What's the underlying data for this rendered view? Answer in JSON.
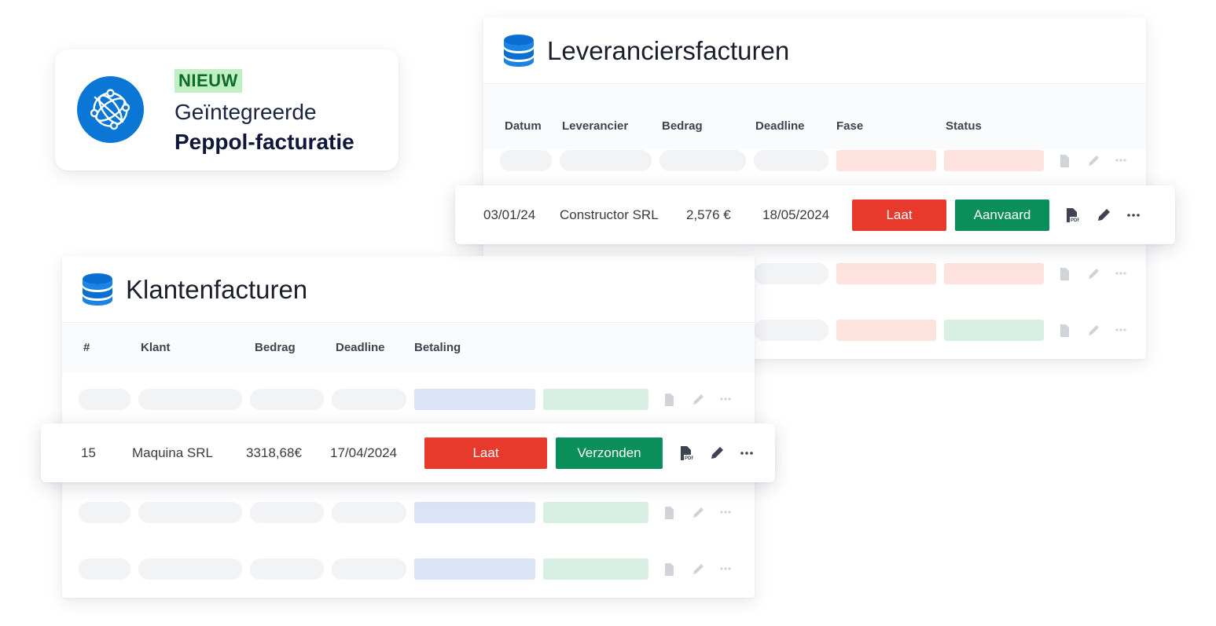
{
  "promo": {
    "tag": "NIEUW",
    "line1": "Geïntegreerde",
    "line2": "Peppol-facturatie"
  },
  "supplier": {
    "title": "Leveranciersfacturen",
    "columns": [
      "Datum",
      "Leverancier",
      "Bedrag",
      "Deadline",
      "Fase",
      "Status"
    ],
    "highlight": {
      "date": "03/01/24",
      "supplier": "Constructor SRL",
      "amount": "2,576 €",
      "deadline": "18/05/2024",
      "phase": "Laat",
      "status": "Aanvaard"
    }
  },
  "client": {
    "title": "Klantenfacturen",
    "columns": [
      "#",
      "Klant",
      "Bedrag",
      "Deadline",
      "Betaling"
    ],
    "highlight": {
      "number": "15",
      "client": "Maquina SRL",
      "amount": "3318,68€",
      "deadline": "17/04/2024",
      "payment": "Laat",
      "status": "Verzonden"
    }
  },
  "icons": {
    "database": "database-icon",
    "pdf": "pdf-icon",
    "edit": "pencil-icon",
    "more": "more-icon",
    "network": "network-globe-icon"
  },
  "colors": {
    "accent": "#0a76d6",
    "late": "#e8392d",
    "accepted": "#0a8f5a",
    "tag_bg": "#bff0c4"
  }
}
